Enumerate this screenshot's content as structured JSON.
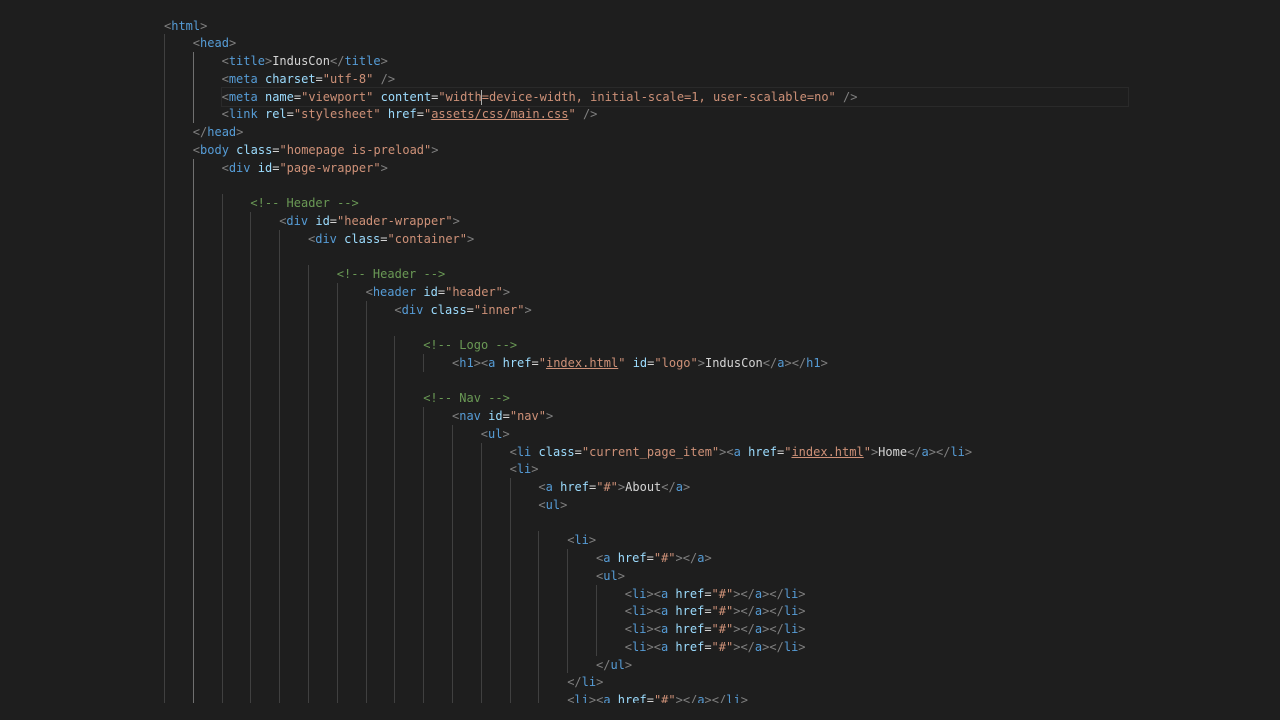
{
  "editor": {
    "language": "html",
    "cursor": {
      "line": 5
    },
    "colors": {
      "background": "#1e1e1e",
      "tag": "#569cd6",
      "attribute": "#9cdcfe",
      "string": "#ce9178",
      "comment": "#6a9955",
      "text": "#d4d4d4",
      "bracket": "#808080",
      "indent_guide": "#404040"
    },
    "lines": [
      {
        "indent": 0,
        "tokens": [
          [
            "b",
            "<"
          ],
          [
            "t",
            "html"
          ],
          [
            "b",
            ">"
          ]
        ]
      },
      {
        "indent": 1,
        "tokens": [
          [
            "b",
            "<"
          ],
          [
            "t",
            "head"
          ],
          [
            "b",
            ">"
          ]
        ]
      },
      {
        "indent": 2,
        "tokens": [
          [
            "b",
            "<"
          ],
          [
            "t",
            "title"
          ],
          [
            "b",
            ">"
          ],
          [
            "x",
            "IndusCon"
          ],
          [
            "b",
            "</"
          ],
          [
            "t",
            "title"
          ],
          [
            "b",
            ">"
          ]
        ]
      },
      {
        "indent": 2,
        "tokens": [
          [
            "b",
            "<"
          ],
          [
            "t",
            "meta"
          ],
          [
            "x",
            " "
          ],
          [
            "a",
            "charset"
          ],
          [
            "x",
            "="
          ],
          [
            "s",
            "\"utf-8\""
          ],
          [
            "x",
            " "
          ],
          [
            "b",
            "/>"
          ]
        ]
      },
      {
        "indent": 2,
        "current": true,
        "tokens": [
          [
            "b",
            "<"
          ],
          [
            "t",
            "meta"
          ],
          [
            "x",
            " "
          ],
          [
            "a",
            "name"
          ],
          [
            "x",
            "="
          ],
          [
            "s",
            "\"viewport\""
          ],
          [
            "x",
            " "
          ],
          [
            "a",
            "content"
          ],
          [
            "x",
            "="
          ],
          [
            "s",
            "\"width"
          ],
          [
            "cursor",
            ""
          ],
          [
            "s",
            "=device-width, initial-scale=1, user-scalable=no\""
          ],
          [
            "x",
            " "
          ],
          [
            "b",
            "/>"
          ]
        ]
      },
      {
        "indent": 2,
        "tokens": [
          [
            "b",
            "<"
          ],
          [
            "t",
            "link"
          ],
          [
            "x",
            " "
          ],
          [
            "a",
            "rel"
          ],
          [
            "x",
            "="
          ],
          [
            "s",
            "\"stylesheet\""
          ],
          [
            "x",
            " "
          ],
          [
            "a",
            "href"
          ],
          [
            "x",
            "="
          ],
          [
            "s",
            "\""
          ],
          [
            "u",
            "assets/css/main.css"
          ],
          [
            "s",
            "\""
          ],
          [
            "x",
            " "
          ],
          [
            "b",
            "/>"
          ]
        ]
      },
      {
        "indent": 1,
        "tokens": [
          [
            "b",
            "</"
          ],
          [
            "t",
            "head"
          ],
          [
            "b",
            ">"
          ]
        ]
      },
      {
        "indent": 1,
        "tokens": [
          [
            "b",
            "<"
          ],
          [
            "t",
            "body"
          ],
          [
            "x",
            " "
          ],
          [
            "a",
            "class"
          ],
          [
            "x",
            "="
          ],
          [
            "s",
            "\"homepage is-preload\""
          ],
          [
            "b",
            ">"
          ]
        ]
      },
      {
        "indent": 2,
        "tokens": [
          [
            "b",
            "<"
          ],
          [
            "t",
            "div"
          ],
          [
            "x",
            " "
          ],
          [
            "a",
            "id"
          ],
          [
            "x",
            "="
          ],
          [
            "s",
            "\"page-wrapper\""
          ],
          [
            "b",
            ">"
          ]
        ]
      },
      {
        "indent": 2,
        "tokens": []
      },
      {
        "indent": 3,
        "tokens": [
          [
            "c",
            "<!-- Header -->"
          ]
        ]
      },
      {
        "indent": 4,
        "tokens": [
          [
            "b",
            "<"
          ],
          [
            "t",
            "div"
          ],
          [
            "x",
            " "
          ],
          [
            "a",
            "id"
          ],
          [
            "x",
            "="
          ],
          [
            "s",
            "\"header-wrapper\""
          ],
          [
            "b",
            ">"
          ]
        ]
      },
      {
        "indent": 5,
        "tokens": [
          [
            "b",
            "<"
          ],
          [
            "t",
            "div"
          ],
          [
            "x",
            " "
          ],
          [
            "a",
            "class"
          ],
          [
            "x",
            "="
          ],
          [
            "s",
            "\"container\""
          ],
          [
            "b",
            ">"
          ]
        ]
      },
      {
        "indent": 5,
        "tokens": []
      },
      {
        "indent": 6,
        "tokens": [
          [
            "c",
            "<!-- Header -->"
          ]
        ]
      },
      {
        "indent": 7,
        "tokens": [
          [
            "b",
            "<"
          ],
          [
            "t",
            "header"
          ],
          [
            "x",
            " "
          ],
          [
            "a",
            "id"
          ],
          [
            "x",
            "="
          ],
          [
            "s",
            "\"header\""
          ],
          [
            "b",
            ">"
          ]
        ]
      },
      {
        "indent": 8,
        "tokens": [
          [
            "b",
            "<"
          ],
          [
            "t",
            "div"
          ],
          [
            "x",
            " "
          ],
          [
            "a",
            "class"
          ],
          [
            "x",
            "="
          ],
          [
            "s",
            "\"inner\""
          ],
          [
            "b",
            ">"
          ]
        ]
      },
      {
        "indent": 8,
        "tokens": []
      },
      {
        "indent": 9,
        "tokens": [
          [
            "c",
            "<!-- Logo -->"
          ]
        ]
      },
      {
        "indent": 10,
        "tokens": [
          [
            "b",
            "<"
          ],
          [
            "t",
            "h1"
          ],
          [
            "b",
            "><"
          ],
          [
            "t",
            "a"
          ],
          [
            "x",
            " "
          ],
          [
            "a",
            "href"
          ],
          [
            "x",
            "="
          ],
          [
            "s",
            "\""
          ],
          [
            "u",
            "index.html"
          ],
          [
            "s",
            "\""
          ],
          [
            "x",
            " "
          ],
          [
            "a",
            "id"
          ],
          [
            "x",
            "="
          ],
          [
            "s",
            "\"logo\""
          ],
          [
            "b",
            ">"
          ],
          [
            "x",
            "IndusCon"
          ],
          [
            "b",
            "</"
          ],
          [
            "t",
            "a"
          ],
          [
            "b",
            "></"
          ],
          [
            "t",
            "h1"
          ],
          [
            "b",
            ">"
          ]
        ]
      },
      {
        "indent": 9,
        "tokens": []
      },
      {
        "indent": 9,
        "tokens": [
          [
            "c",
            "<!-- Nav -->"
          ]
        ]
      },
      {
        "indent": 10,
        "tokens": [
          [
            "b",
            "<"
          ],
          [
            "t",
            "nav"
          ],
          [
            "x",
            " "
          ],
          [
            "a",
            "id"
          ],
          [
            "x",
            "="
          ],
          [
            "s",
            "\"nav\""
          ],
          [
            "b",
            ">"
          ]
        ]
      },
      {
        "indent": 11,
        "tokens": [
          [
            "b",
            "<"
          ],
          [
            "t",
            "ul"
          ],
          [
            "b",
            ">"
          ]
        ]
      },
      {
        "indent": 12,
        "tokens": [
          [
            "b",
            "<"
          ],
          [
            "t",
            "li"
          ],
          [
            "x",
            " "
          ],
          [
            "a",
            "class"
          ],
          [
            "x",
            "="
          ],
          [
            "s",
            "\"current_page_item\""
          ],
          [
            "b",
            "><"
          ],
          [
            "t",
            "a"
          ],
          [
            "x",
            " "
          ],
          [
            "a",
            "href"
          ],
          [
            "x",
            "="
          ],
          [
            "s",
            "\""
          ],
          [
            "u",
            "index.html"
          ],
          [
            "s",
            "\""
          ],
          [
            "b",
            ">"
          ],
          [
            "x",
            "Home"
          ],
          [
            "b",
            "</"
          ],
          [
            "t",
            "a"
          ],
          [
            "b",
            "></"
          ],
          [
            "t",
            "li"
          ],
          [
            "b",
            ">"
          ]
        ]
      },
      {
        "indent": 12,
        "tokens": [
          [
            "b",
            "<"
          ],
          [
            "t",
            "li"
          ],
          [
            "b",
            ">"
          ]
        ]
      },
      {
        "indent": 13,
        "tokens": [
          [
            "b",
            "<"
          ],
          [
            "t",
            "a"
          ],
          [
            "x",
            " "
          ],
          [
            "a",
            "href"
          ],
          [
            "x",
            "="
          ],
          [
            "s",
            "\"#\""
          ],
          [
            "b",
            ">"
          ],
          [
            "x",
            "About"
          ],
          [
            "b",
            "</"
          ],
          [
            "t",
            "a"
          ],
          [
            "b",
            ">"
          ]
        ]
      },
      {
        "indent": 13,
        "tokens": [
          [
            "b",
            "<"
          ],
          [
            "t",
            "ul"
          ],
          [
            "b",
            ">"
          ]
        ]
      },
      {
        "indent": 13,
        "tokens": []
      },
      {
        "indent": 14,
        "tokens": [
          [
            "b",
            "<"
          ],
          [
            "t",
            "li"
          ],
          [
            "b",
            ">"
          ]
        ]
      },
      {
        "indent": 15,
        "tokens": [
          [
            "b",
            "<"
          ],
          [
            "t",
            "a"
          ],
          [
            "x",
            " "
          ],
          [
            "a",
            "href"
          ],
          [
            "x",
            "="
          ],
          [
            "s",
            "\"#\""
          ],
          [
            "b",
            "></"
          ],
          [
            "t",
            "a"
          ],
          [
            "b",
            ">"
          ]
        ]
      },
      {
        "indent": 15,
        "tokens": [
          [
            "b",
            "<"
          ],
          [
            "t",
            "ul"
          ],
          [
            "b",
            ">"
          ]
        ]
      },
      {
        "indent": 16,
        "tokens": [
          [
            "b",
            "<"
          ],
          [
            "t",
            "li"
          ],
          [
            "b",
            "><"
          ],
          [
            "t",
            "a"
          ],
          [
            "x",
            " "
          ],
          [
            "a",
            "href"
          ],
          [
            "x",
            "="
          ],
          [
            "s",
            "\"#\""
          ],
          [
            "b",
            "></"
          ],
          [
            "t",
            "a"
          ],
          [
            "b",
            "></"
          ],
          [
            "t",
            "li"
          ],
          [
            "b",
            ">"
          ]
        ]
      },
      {
        "indent": 16,
        "tokens": [
          [
            "b",
            "<"
          ],
          [
            "t",
            "li"
          ],
          [
            "b",
            "><"
          ],
          [
            "t",
            "a"
          ],
          [
            "x",
            " "
          ],
          [
            "a",
            "href"
          ],
          [
            "x",
            "="
          ],
          [
            "s",
            "\"#\""
          ],
          [
            "b",
            "></"
          ],
          [
            "t",
            "a"
          ],
          [
            "b",
            "></"
          ],
          [
            "t",
            "li"
          ],
          [
            "b",
            ">"
          ]
        ]
      },
      {
        "indent": 16,
        "tokens": [
          [
            "b",
            "<"
          ],
          [
            "t",
            "li"
          ],
          [
            "b",
            "><"
          ],
          [
            "t",
            "a"
          ],
          [
            "x",
            " "
          ],
          [
            "a",
            "href"
          ],
          [
            "x",
            "="
          ],
          [
            "s",
            "\"#\""
          ],
          [
            "b",
            "></"
          ],
          [
            "t",
            "a"
          ],
          [
            "b",
            "></"
          ],
          [
            "t",
            "li"
          ],
          [
            "b",
            ">"
          ]
        ]
      },
      {
        "indent": 16,
        "tokens": [
          [
            "b",
            "<"
          ],
          [
            "t",
            "li"
          ],
          [
            "b",
            "><"
          ],
          [
            "t",
            "a"
          ],
          [
            "x",
            " "
          ],
          [
            "a",
            "href"
          ],
          [
            "x",
            "="
          ],
          [
            "s",
            "\"#\""
          ],
          [
            "b",
            "></"
          ],
          [
            "t",
            "a"
          ],
          [
            "b",
            "></"
          ],
          [
            "t",
            "li"
          ],
          [
            "b",
            ">"
          ]
        ]
      },
      {
        "indent": 15,
        "tokens": [
          [
            "b",
            "</"
          ],
          [
            "t",
            "ul"
          ],
          [
            "b",
            ">"
          ]
        ]
      },
      {
        "indent": 14,
        "tokens": [
          [
            "b",
            "</"
          ],
          [
            "t",
            "li"
          ],
          [
            "b",
            ">"
          ]
        ]
      },
      {
        "indent": 14,
        "tokens": [
          [
            "b",
            "<"
          ],
          [
            "t",
            "li"
          ],
          [
            "b",
            "><"
          ],
          [
            "t",
            "a"
          ],
          [
            "x",
            " "
          ],
          [
            "a",
            "href"
          ],
          [
            "x",
            "="
          ],
          [
            "s",
            "\"#\""
          ],
          [
            "b",
            "></"
          ],
          [
            "t",
            "a"
          ],
          [
            "b",
            "></"
          ],
          [
            "t",
            "li"
          ],
          [
            "b",
            ">"
          ]
        ]
      }
    ]
  }
}
